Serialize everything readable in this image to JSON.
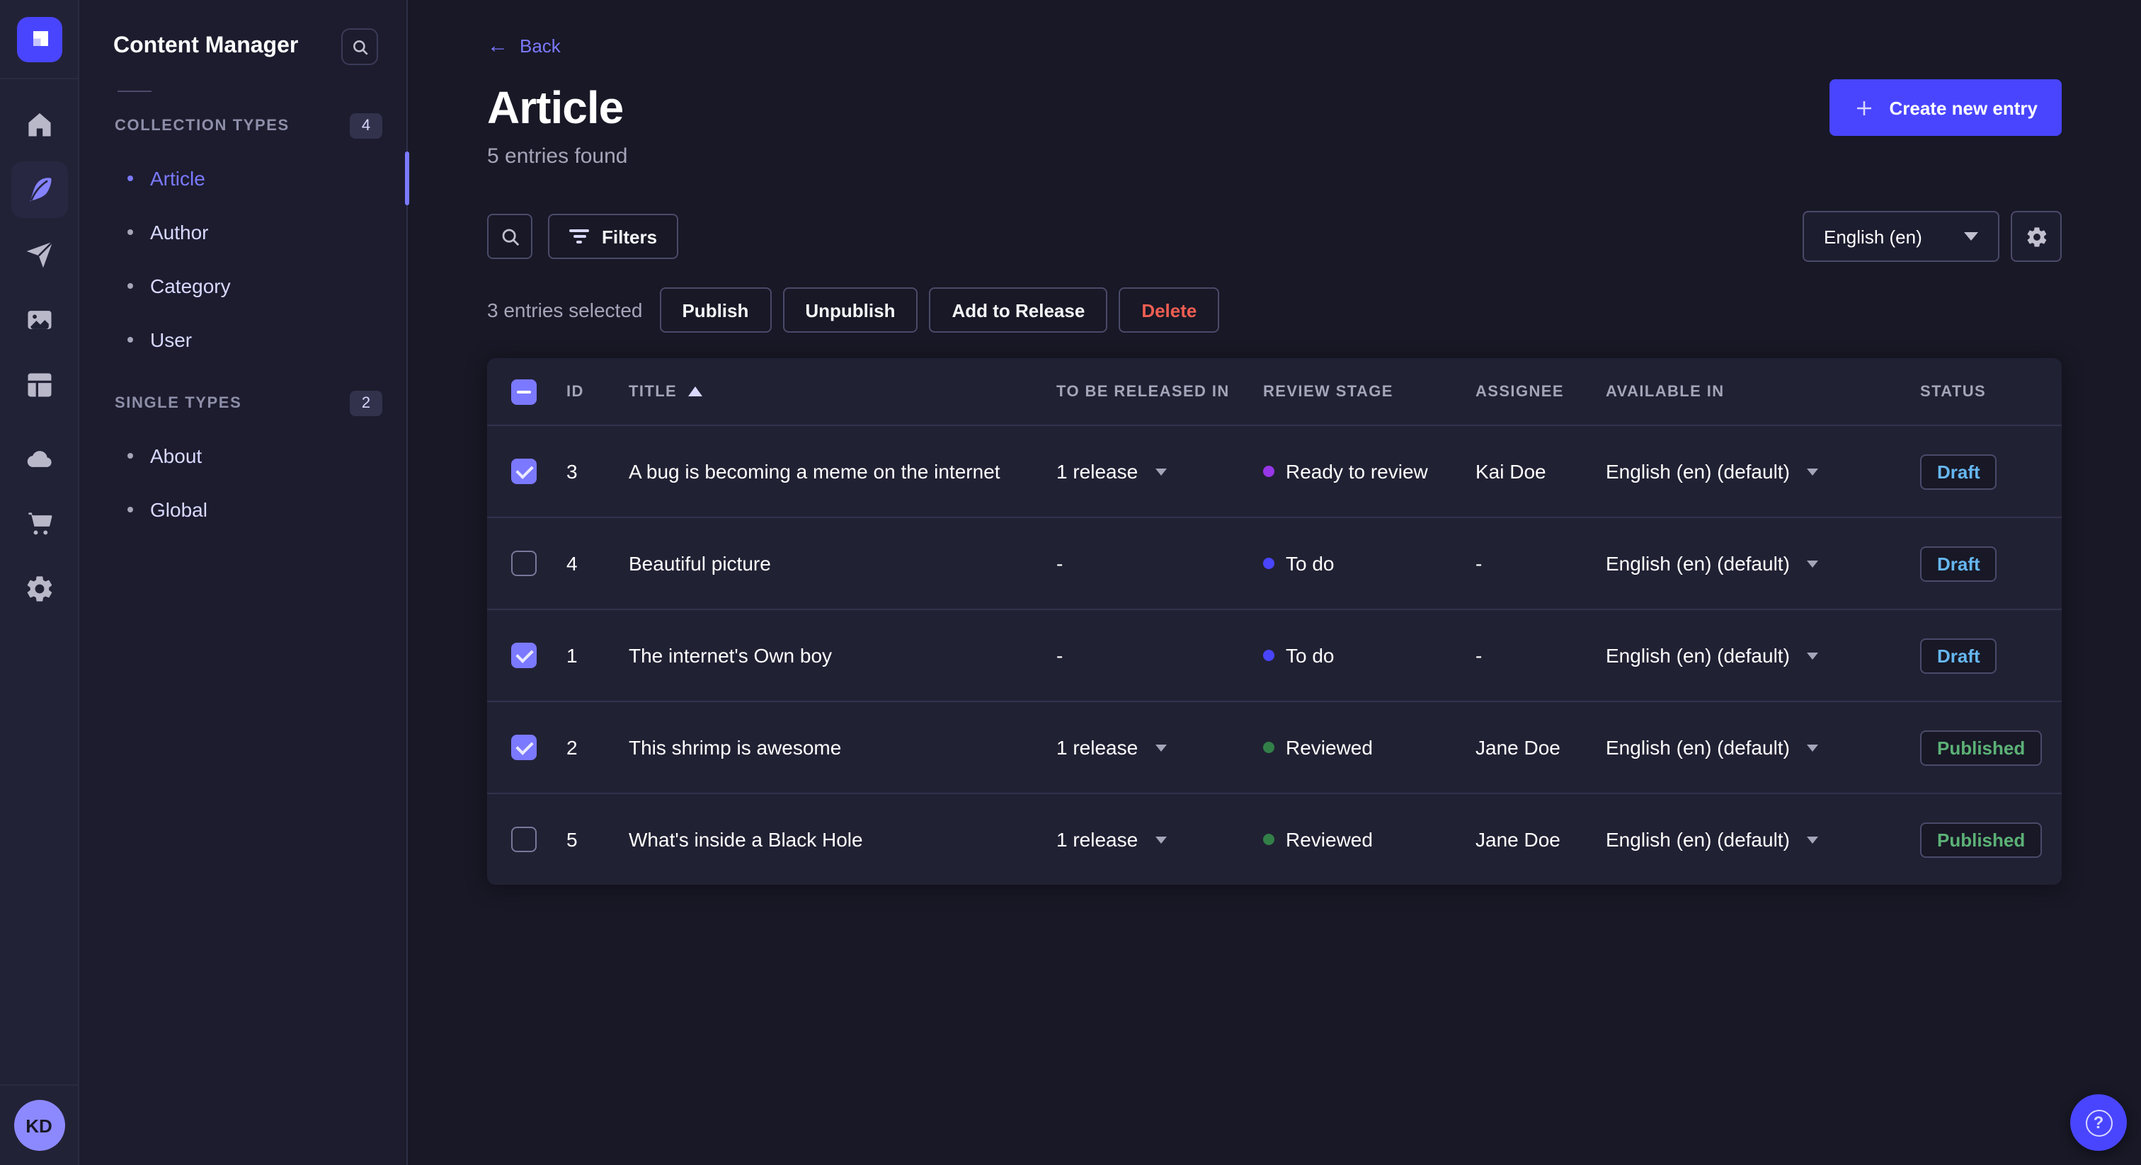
{
  "app": {
    "accent": "#4945ff",
    "accent_light": "#7b79ff"
  },
  "rail": {
    "items": [
      "home",
      "content-manager",
      "releases",
      "media-library",
      "content-type-builder",
      "deploy-cloud",
      "marketplace",
      "settings"
    ],
    "active_item": "content-manager",
    "avatar_initials": "KD"
  },
  "subnav": {
    "title": "Content Manager",
    "sections": [
      {
        "label": "COLLECTION TYPES",
        "count": "4",
        "items": [
          {
            "label": "Article",
            "active": true
          },
          {
            "label": "Author"
          },
          {
            "label": "Category"
          },
          {
            "label": "User"
          }
        ]
      },
      {
        "label": "SINGLE TYPES",
        "count": "2",
        "items": [
          {
            "label": "About"
          },
          {
            "label": "Global"
          }
        ]
      }
    ]
  },
  "header": {
    "back_label": "Back",
    "title": "Article",
    "subtitle": "5 entries found",
    "create_button": "Create new entry"
  },
  "toolbar": {
    "filters_label": "Filters",
    "locale_value": "English (en)",
    "selected_text": "3 entries selected",
    "publish": "Publish",
    "unpublish": "Unpublish",
    "add_to_release": "Add to Release",
    "delete": "Delete"
  },
  "table": {
    "columns": [
      "ID",
      "TITLE",
      "TO BE RELEASED IN",
      "REVIEW STAGE",
      "ASSIGNEE",
      "AVAILABLE IN",
      "STATUS"
    ],
    "sorted_column": "TITLE",
    "sort_direction": "asc",
    "stage_colors": {
      "To do": "#4945ff",
      "Ready to review": "#9736e8",
      "Reviewed": "#328048"
    },
    "status_colors": {
      "Draft": "#66b7f1",
      "Published": "#5cb176"
    },
    "rows": [
      {
        "checked": true,
        "id": "3",
        "title": "A bug is becoming a meme on the internet",
        "released_in": "1 release",
        "review_stage": "Ready to review",
        "stage_color": "#9736e8",
        "assignee": "Kai Doe",
        "available_in": "English (en) (default)",
        "status": "Draft",
        "status_color": "#66b7f1"
      },
      {
        "checked": false,
        "id": "4",
        "title": "Beautiful picture",
        "released_in": "-",
        "review_stage": "To do",
        "stage_color": "#4945ff",
        "assignee": "-",
        "available_in": "English (en) (default)",
        "status": "Draft",
        "status_color": "#66b7f1"
      },
      {
        "checked": true,
        "id": "1",
        "title": "The internet's Own boy",
        "released_in": "-",
        "review_stage": "To do",
        "stage_color": "#4945ff",
        "assignee": "-",
        "available_in": "English (en) (default)",
        "status": "Draft",
        "status_color": "#66b7f1"
      },
      {
        "checked": true,
        "id": "2",
        "title": "This shrimp is awesome",
        "released_in": "1 release",
        "review_stage": "Reviewed",
        "stage_color": "#328048",
        "assignee": "Jane Doe",
        "available_in": "English (en) (default)",
        "status": "Published",
        "status_color": "#5cb176"
      },
      {
        "checked": false,
        "id": "5",
        "title": "What's inside a Black Hole",
        "released_in": "1 release",
        "review_stage": "Reviewed",
        "stage_color": "#328048",
        "assignee": "Jane Doe",
        "available_in": "English (en) (default)",
        "status": "Published",
        "status_color": "#5cb176"
      }
    ]
  },
  "help": {
    "icon": "question-mark"
  }
}
